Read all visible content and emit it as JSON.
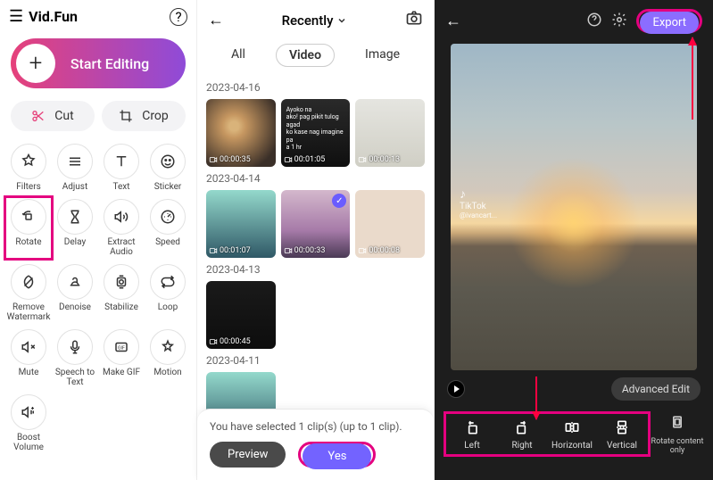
{
  "panel1": {
    "app_name": "Vid.Fun",
    "start_label": "Start Editing",
    "cut_label": "Cut",
    "crop_label": "Crop",
    "tools": [
      {
        "id": "filters",
        "label": "Filters"
      },
      {
        "id": "adjust",
        "label": "Adjust"
      },
      {
        "id": "text",
        "label": "Text"
      },
      {
        "id": "sticker",
        "label": "Sticker"
      },
      {
        "id": "rotate",
        "label": "Rotate",
        "highlight": true
      },
      {
        "id": "delay",
        "label": "Delay"
      },
      {
        "id": "extract",
        "label": "Extract Audio"
      },
      {
        "id": "speed",
        "label": "Speed"
      },
      {
        "id": "watermark",
        "label": "Remove Watermark"
      },
      {
        "id": "denoise",
        "label": "Denoise"
      },
      {
        "id": "stabilize",
        "label": "Stabilize"
      },
      {
        "id": "loop",
        "label": "Loop"
      },
      {
        "id": "mute",
        "label": "Mute"
      },
      {
        "id": "stt",
        "label": "Speech to Text"
      },
      {
        "id": "gif",
        "label": "Make GIF"
      },
      {
        "id": "motion",
        "label": "Motion"
      },
      {
        "id": "boost",
        "label": "Boost Volume"
      }
    ]
  },
  "panel2": {
    "title": "Recently",
    "tabs": {
      "all": "All",
      "video": "Video",
      "image": "Image"
    },
    "groups": [
      {
        "date": "2023-04-16",
        "items": [
          {
            "ts": "00:00:35",
            "cls": "t1a"
          },
          {
            "ts": "00:01:05",
            "cls": "t1b",
            "text": "Ayoko na\nako! pag pikit tulog agad\nko kase nag imagine pa\na 1 hr"
          },
          {
            "ts": "00:00:13",
            "cls": "t1c"
          }
        ]
      },
      {
        "date": "2023-04-14",
        "items": [
          {
            "ts": "00:01:07",
            "cls": "t2a"
          },
          {
            "ts": "00:00:33",
            "cls": "t2b",
            "checked": true
          },
          {
            "ts": "00:00:08",
            "cls": "t2c"
          }
        ]
      },
      {
        "date": "2023-04-13",
        "items": [
          {
            "ts": "00:00:45",
            "cls": "t3a"
          }
        ]
      },
      {
        "date": "2023-04-11",
        "items": [
          {
            "ts": "",
            "cls": "t2a"
          }
        ]
      }
    ],
    "selected_text": "You have selected 1 clip(s) (up to 1 clip).",
    "preview": "Preview",
    "yes": "Yes"
  },
  "panel3": {
    "export": "Export",
    "tiktok_handle": "@ivancart...",
    "tiktok": "TikTok",
    "advanced": "Advanced Edit",
    "rotate_btns": [
      {
        "id": "left",
        "label": "Left"
      },
      {
        "id": "right",
        "label": "Right"
      },
      {
        "id": "horiz",
        "label": "Horizontal"
      },
      {
        "id": "vert",
        "label": "Vertical"
      }
    ],
    "rco": "Rotate content only"
  }
}
